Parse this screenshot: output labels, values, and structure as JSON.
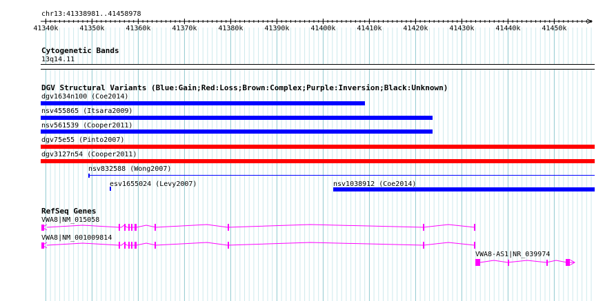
{
  "ruler": {
    "region": "chr13:41338981..41458978",
    "ticks": [
      "41340k",
      "41350k",
      "41360k",
      "41370k",
      "41380k",
      "41390k",
      "41400k",
      "41410k",
      "41420k",
      "41430k",
      "41440k",
      "41450k"
    ]
  },
  "cytoband_track": {
    "title": "Cytogenetic Bands",
    "band": "13q14.11"
  },
  "dgv_track": {
    "title": "DGV Structural Variants (Blue:Gain;Red:Loss;Brown:Complex;Purple:Inversion;Black:Unknown)",
    "colors": {
      "gain": "#0000ff",
      "loss": "#ff0000"
    },
    "variants": [
      {
        "label": "dgv1634n100 (Coe2014)",
        "type": "gain"
      },
      {
        "label": "nsv455865 (Itsara2009)",
        "type": "gain"
      },
      {
        "label": "nsv561539 (Cooper2011)",
        "type": "gain"
      },
      {
        "label": "dgv75e55 (Pinto2007)",
        "type": "loss"
      },
      {
        "label": "dgv3127n54 (Cooper2011)",
        "type": "loss"
      },
      {
        "label": "nsv832588 (Wong2007)",
        "type": "gain"
      },
      {
        "label": "esv1655024 (Levy2007)",
        "type": "gain"
      },
      {
        "label": "nsv1038912 (Coe2014)",
        "type": "gain"
      }
    ]
  },
  "refseq_track": {
    "title": "RefSeq Genes",
    "color": "#ff00ff",
    "genes": [
      {
        "label": "VWA8|NM_015058",
        "strand": "minus"
      },
      {
        "label": "VWA8|NM_001009814",
        "strand": "minus"
      },
      {
        "label": "VWA8-AS1|NR_039974",
        "strand": "plus"
      }
    ]
  }
}
